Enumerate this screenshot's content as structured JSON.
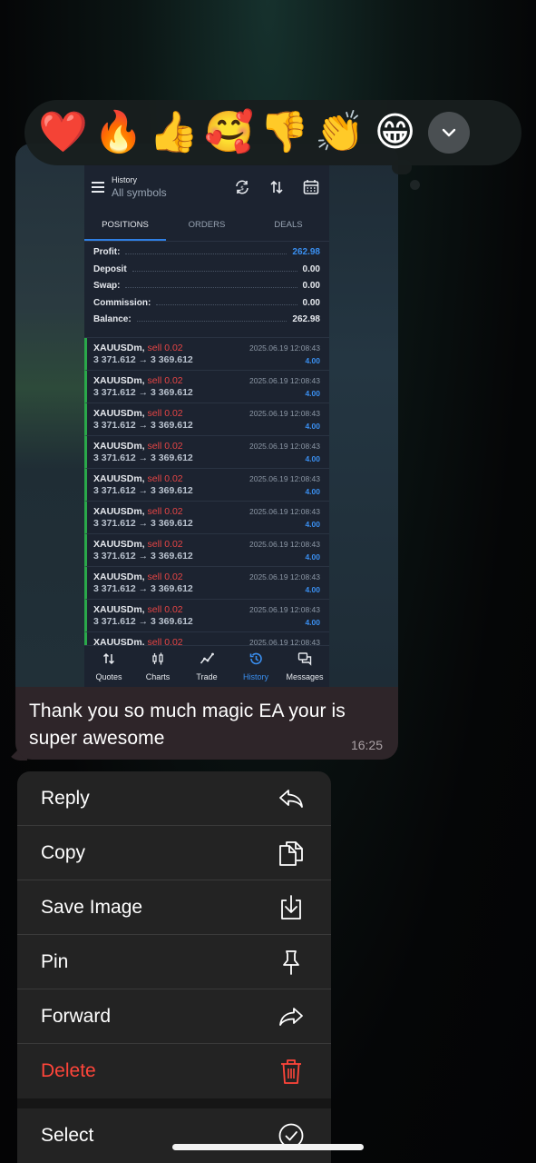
{
  "reactions": [
    "❤️",
    "🔥",
    "👍",
    "🥰",
    "👎",
    "👏",
    "😁"
  ],
  "reaction_more_icon": "chevron-down-icon",
  "screenshot": {
    "header": {
      "small_title": "History",
      "subtitle": "All symbols"
    },
    "tabs": [
      "POSITIONS",
      "ORDERS",
      "DEALS"
    ],
    "active_tab": "POSITIONS",
    "summary": [
      {
        "label": "Profit:",
        "value": "262.98"
      },
      {
        "label": "Deposit",
        "value": "0.00"
      },
      {
        "label": "Swap:",
        "value": "0.00"
      },
      {
        "label": "Commission:",
        "value": "0.00"
      },
      {
        "label": "Balance:",
        "value": "262.98"
      }
    ],
    "trades": [
      {
        "symbol": "XAUUSDm,",
        "action": "sell 0.02",
        "prices": "3 371.612 → 3 369.612",
        "date": "2025.06.19 12:08:43",
        "profit": "4.00"
      },
      {
        "symbol": "XAUUSDm,",
        "action": "sell 0.02",
        "prices": "3 371.612 → 3 369.612",
        "date": "2025.06.19 12:08:43",
        "profit": "4.00"
      },
      {
        "symbol": "XAUUSDm,",
        "action": "sell 0.02",
        "prices": "3 371.612 → 3 369.612",
        "date": "2025.06.19 12:08:43",
        "profit": "4.00"
      },
      {
        "symbol": "XAUUSDm,",
        "action": "sell 0.02",
        "prices": "3 371.612 → 3 369.612",
        "date": "2025.06.19 12:08:43",
        "profit": "4.00"
      },
      {
        "symbol": "XAUUSDm,",
        "action": "sell 0.02",
        "prices": "3 371.612 → 3 369.612",
        "date": "2025.06.19 12:08:43",
        "profit": "4.00"
      },
      {
        "symbol": "XAUUSDm,",
        "action": "sell 0.02",
        "prices": "3 371.612 → 3 369.612",
        "date": "2025.06.19 12:08:43",
        "profit": "4.00"
      },
      {
        "symbol": "XAUUSDm,",
        "action": "sell 0.02",
        "prices": "3 371.612 → 3 369.612",
        "date": "2025.06.19 12:08:43",
        "profit": "4.00"
      },
      {
        "symbol": "XAUUSDm,",
        "action": "sell 0.02",
        "prices": "3 371.612 → 3 369.612",
        "date": "2025.06.19 12:08:43",
        "profit": "4.00"
      },
      {
        "symbol": "XAUUSDm,",
        "action": "sell 0.02",
        "prices": "3 371.612 → 3 369.612",
        "date": "2025.06.19 12:08:43",
        "profit": "4.00"
      },
      {
        "symbol": "XAUUSDm,",
        "action": "sell 0.02",
        "prices": "",
        "date": "2025.06.19 12:08:43",
        "profit": ""
      }
    ],
    "nav": [
      "Quotes",
      "Charts",
      "Trade",
      "History",
      "Messages"
    ],
    "active_nav": "History"
  },
  "message": {
    "text": "Thank you so much magic EA your is super awesome",
    "time": "16:25"
  },
  "menu": {
    "reply": "Reply",
    "copy": "Copy",
    "save_image": "Save Image",
    "pin": "Pin",
    "forward": "Forward",
    "delete": "Delete",
    "select": "Select"
  },
  "colors": {
    "accent_blue": "#3a8ff0",
    "sell_red": "#e64545",
    "delete_red": "#ff453a",
    "bubble": "#2e2529",
    "menu_bg": "#232323"
  }
}
